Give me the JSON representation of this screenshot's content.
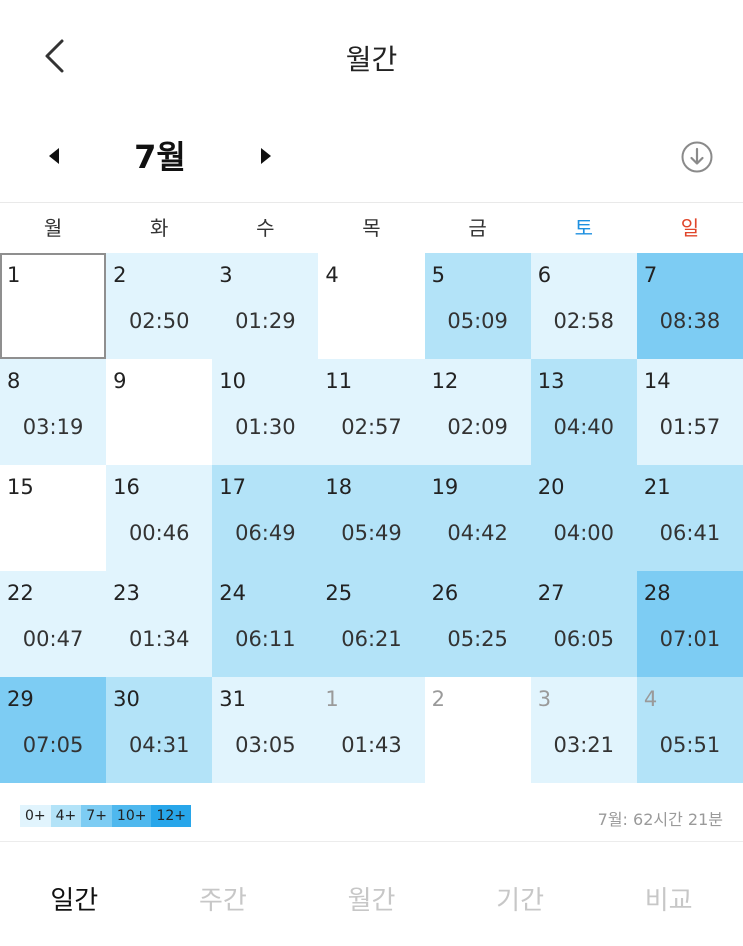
{
  "header": {
    "title": "월간"
  },
  "month_nav": {
    "label": "7월"
  },
  "icons": {
    "back": "back-arrow-icon",
    "prev": "triangle-left-icon",
    "next": "triangle-right-icon",
    "download": "download-circle-icon"
  },
  "weekdays": [
    {
      "label": "월",
      "color": "#333333"
    },
    {
      "label": "화",
      "color": "#333333"
    },
    {
      "label": "수",
      "color": "#333333"
    },
    {
      "label": "목",
      "color": "#333333"
    },
    {
      "label": "금",
      "color": "#333333"
    },
    {
      "label": "토",
      "color": "#1e90e0"
    },
    {
      "label": "일",
      "color": "#e0452a"
    }
  ],
  "days": [
    {
      "day": "1",
      "time": "",
      "level": 0,
      "selected": true
    },
    {
      "day": "2",
      "time": "02:50",
      "level": 1
    },
    {
      "day": "3",
      "time": "01:29",
      "level": 1
    },
    {
      "day": "4",
      "time": "",
      "level": 0
    },
    {
      "day": "5",
      "time": "05:09",
      "level": 2
    },
    {
      "day": "6",
      "time": "02:58",
      "level": 1
    },
    {
      "day": "7",
      "time": "08:38",
      "level": 3
    },
    {
      "day": "8",
      "time": "03:19",
      "level": 1
    },
    {
      "day": "9",
      "time": "",
      "level": 0
    },
    {
      "day": "10",
      "time": "01:30",
      "level": 1
    },
    {
      "day": "11",
      "time": "02:57",
      "level": 1
    },
    {
      "day": "12",
      "time": "02:09",
      "level": 1
    },
    {
      "day": "13",
      "time": "04:40",
      "level": 2
    },
    {
      "day": "14",
      "time": "01:57",
      "level": 1
    },
    {
      "day": "15",
      "time": "",
      "level": 0
    },
    {
      "day": "16",
      "time": "00:46",
      "level": 1
    },
    {
      "day": "17",
      "time": "06:49",
      "level": 2
    },
    {
      "day": "18",
      "time": "05:49",
      "level": 2
    },
    {
      "day": "19",
      "time": "04:42",
      "level": 2
    },
    {
      "day": "20",
      "time": "04:00",
      "level": 2
    },
    {
      "day": "21",
      "time": "06:41",
      "level": 2
    },
    {
      "day": "22",
      "time": "00:47",
      "level": 1
    },
    {
      "day": "23",
      "time": "01:34",
      "level": 1
    },
    {
      "day": "24",
      "time": "06:11",
      "level": 2
    },
    {
      "day": "25",
      "time": "06:21",
      "level": 2
    },
    {
      "day": "26",
      "time": "05:25",
      "level": 2
    },
    {
      "day": "27",
      "time": "06:05",
      "level": 2
    },
    {
      "day": "28",
      "time": "07:01",
      "level": 3
    },
    {
      "day": "29",
      "time": "07:05",
      "level": 3
    },
    {
      "day": "30",
      "time": "04:31",
      "level": 2
    },
    {
      "day": "31",
      "time": "03:05",
      "level": 1
    },
    {
      "day": "1",
      "time": "01:43",
      "level": 1,
      "other": true
    },
    {
      "day": "2",
      "time": "",
      "level": 0,
      "other": true
    },
    {
      "day": "3",
      "time": "03:21",
      "level": 1,
      "other": true
    },
    {
      "day": "4",
      "time": "05:51",
      "level": 2,
      "other": true
    }
  ],
  "level_colors": [
    "#ffffff",
    "#e1f4fd",
    "#b3e3f8",
    "#7dccf3"
  ],
  "legend": [
    {
      "label": "0+",
      "color": "#e1f4fd"
    },
    {
      "label": "4+",
      "color": "#b3e3f8"
    },
    {
      "label": "7+",
      "color": "#7dccf3"
    },
    {
      "label": "10+",
      "color": "#4fb8ee"
    },
    {
      "label": "12+",
      "color": "#28a6ea"
    }
  ],
  "summary": "7월: 62시간 21분",
  "tabs": [
    {
      "label": "일간",
      "active": true
    },
    {
      "label": "주간",
      "active": false
    },
    {
      "label": "월간",
      "active": false
    },
    {
      "label": "기간",
      "active": false
    },
    {
      "label": "비교",
      "active": false
    }
  ]
}
